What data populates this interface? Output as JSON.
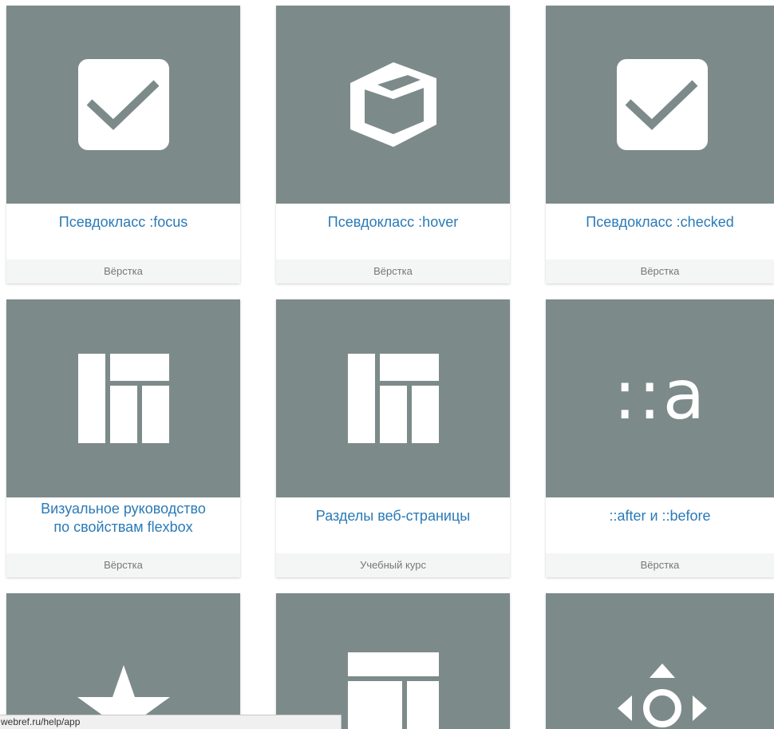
{
  "colors": {
    "thumb_bg": "#7d8a8a",
    "title_link": "#2a7ab7",
    "category_bg": "#f4f5f5",
    "category_text": "#777777"
  },
  "cards": [
    {
      "title": "Псевдокласс :focus",
      "category": "Вёрстка",
      "icon": "checkbox-icon"
    },
    {
      "title": "Псевдокласс :hover",
      "category": "Вёрстка",
      "icon": "box-3d-icon"
    },
    {
      "title": "Псевдокласс :checked",
      "category": "Вёрстка",
      "icon": "checkbox-icon"
    },
    {
      "title_line1": "Визуальное руководство",
      "title_line2": "по свойствам flexbox",
      "category": "Вёрстка",
      "icon": "flex-layout-icon"
    },
    {
      "title": "Разделы веб-страницы",
      "category": "Учебный курс",
      "icon": "page-layout-icon"
    },
    {
      "title": "::after и ::before",
      "category": "Вёрстка",
      "icon": "pseudo-element-icon",
      "glyph": "::a"
    },
    {
      "icon": "star-icon"
    },
    {
      "icon": "page-sections-icon"
    },
    {
      "icon": "move-arrows-icon"
    }
  ],
  "status_bar": {
    "url": "webref.ru/help/app"
  }
}
